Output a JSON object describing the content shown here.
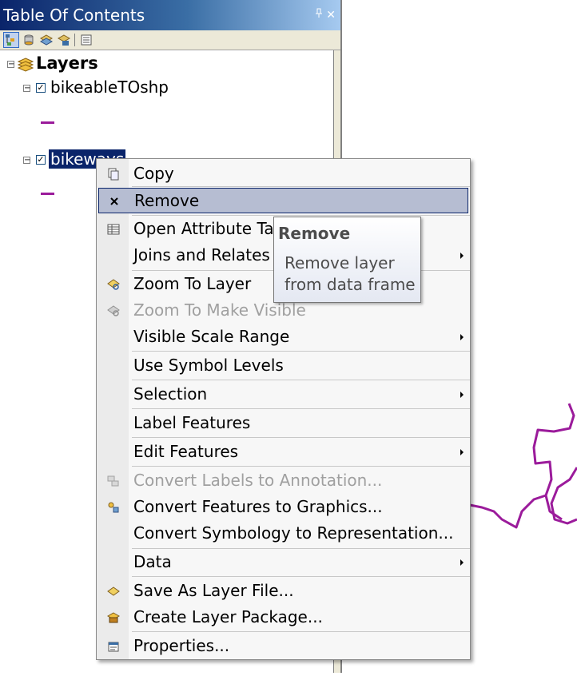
{
  "window": {
    "title": "Table Of Contents",
    "pin_glyph": "ᵖ",
    "close_glyph": "✕"
  },
  "toolbar": {
    "buttons": [
      {
        "icon": "list-by-drawing-order-icon"
      },
      {
        "icon": "list-by-source-icon"
      },
      {
        "icon": "list-by-visibility-icon"
      },
      {
        "icon": "list-by-selection-icon"
      },
      {
        "icon": "options-icon"
      }
    ]
  },
  "tree": {
    "root_label": "Layers",
    "layers": [
      {
        "label": "bikeableTOshp",
        "checked": true,
        "symbol_color": "#9b1b9b"
      },
      {
        "label": "bikeways",
        "checked": true,
        "selected": true,
        "symbol_color": "#9b1b9b"
      }
    ]
  },
  "menu": {
    "items": [
      {
        "label": "Copy",
        "icon": "copy-icon"
      },
      {
        "label": "Remove",
        "icon": "remove-icon",
        "hover": true
      },
      {
        "label": "Open Attribute Table",
        "icon": "table-icon"
      },
      {
        "label": "Joins and Relates",
        "submenu": true
      },
      {
        "label": "Zoom To Layer",
        "icon": "zoom-to-layer-icon"
      },
      {
        "label": "Zoom To Make Visible",
        "icon": "zoom-to-visible-icon",
        "disabled": true
      },
      {
        "label": "Visible Scale Range",
        "submenu": true
      },
      {
        "label": "Use Symbol Levels"
      },
      {
        "label": "Selection",
        "submenu": true
      },
      {
        "label": "Label Features"
      },
      {
        "label": "Edit Features",
        "submenu": true
      },
      {
        "label": "Convert Labels to Annotation...",
        "icon": "convert-labels-icon",
        "disabled": true
      },
      {
        "label": "Convert Features to Graphics...",
        "icon": "convert-features-icon"
      },
      {
        "label": "Convert Symbology to Representation..."
      },
      {
        "label": "Data",
        "submenu": true
      },
      {
        "label": "Save As Layer File...",
        "icon": "save-layer-icon"
      },
      {
        "label": "Create Layer Package...",
        "icon": "layer-package-icon"
      },
      {
        "label": "Properties...",
        "icon": "properties-icon"
      }
    ]
  },
  "tooltip": {
    "title": "Remove",
    "body": "Remove layer from data frame"
  },
  "colors": {
    "title_bar": "#0a246a",
    "selection": "#0a246a",
    "menu_hover": "#b6bdd2",
    "line_symbol": "#9b1b9b"
  }
}
